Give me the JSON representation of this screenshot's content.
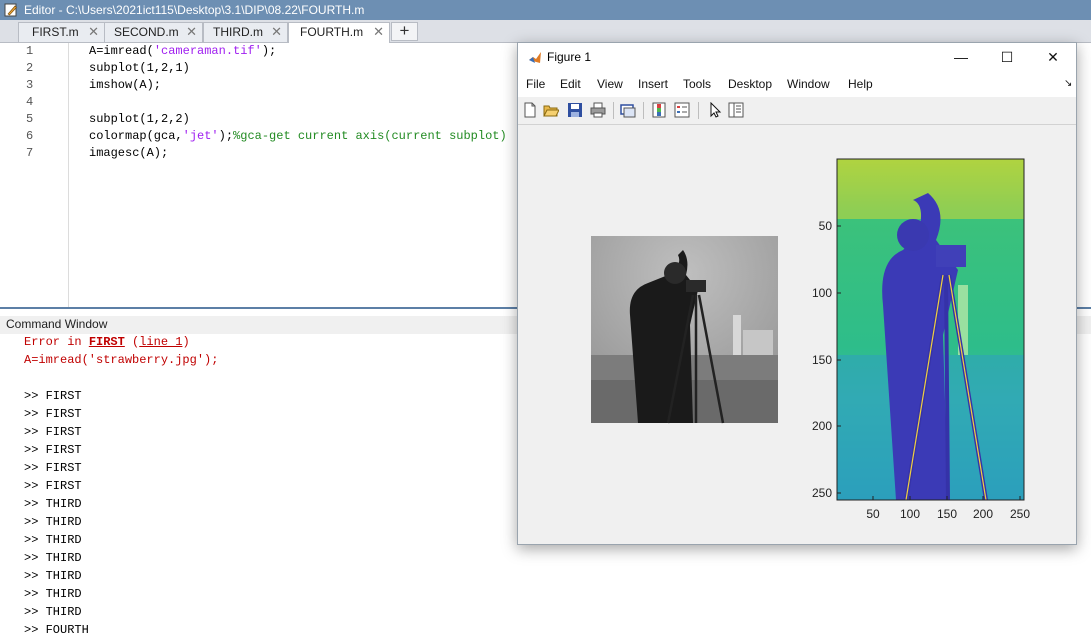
{
  "editor": {
    "title": "Editor - C:\\Users\\2021ict115\\Desktop\\3.1\\DIP\\08.22\\FOURTH.m",
    "tabs": [
      {
        "label": "FIRST.m",
        "active": false
      },
      {
        "label": "SECOND.m",
        "active": false
      },
      {
        "label": "THIRD.m",
        "active": false
      },
      {
        "label": "FOURTH.m",
        "active": true
      }
    ],
    "add_tab_label": "+",
    "close_glyph": "✕",
    "lines": [
      {
        "num": "1",
        "text": "A=imread('cameraman.tif');"
      },
      {
        "num": "2",
        "text": "subplot(1,2,1)"
      },
      {
        "num": "3",
        "text": "imshow(A);"
      },
      {
        "num": "4",
        "text": ""
      },
      {
        "num": "5",
        "text": "subplot(1,2,2)"
      },
      {
        "num": "6",
        "text": "colormap(gca,'jet');%gca-get current axis(current subplot)"
      },
      {
        "num": "7",
        "text": "imagesc(A);"
      }
    ],
    "line1_parts": {
      "a": "A=imread(",
      "s": "'cameraman.tif'",
      "b": ");"
    },
    "line6_parts": {
      "a": "colormap(gca,",
      "s": "'jet'",
      "b": ");",
      "c": "%gca-get current axis(current subplot)"
    }
  },
  "command_window": {
    "title": "Command Window",
    "error_parts": {
      "a": "Error in ",
      "link1": "FIRST",
      "b": " (",
      "link2": "line 1",
      "c": ")"
    },
    "error_line2": "A=imread('strawberry.jpg');",
    "history": [
      ">> FIRST",
      ">> FIRST",
      ">> FIRST",
      ">> FIRST",
      ">> FIRST",
      ">> FIRST",
      ">> THIRD",
      ">> THIRD",
      ">> THIRD",
      ">> THIRD",
      ">> THIRD",
      ">> THIRD",
      ">> THIRD",
      ">> FOURTH"
    ]
  },
  "figure": {
    "title": "Figure 1",
    "window_buttons": {
      "minimize": "—",
      "maximize": "☐",
      "close": "✕"
    },
    "menu": [
      "File",
      "Edit",
      "View",
      "Insert",
      "Tools",
      "Desktop",
      "Window",
      "Help"
    ],
    "menu_arrow": "↘",
    "toolbar_icons": [
      "new-figure-icon",
      "open-file-icon",
      "save-icon",
      "print-icon",
      "link-axes-icon",
      "colorbar-icon",
      "legend-icon",
      "pointer-icon",
      "property-inspector-icon"
    ],
    "axes": {
      "y_ticks": [
        "50",
        "100",
        "150",
        "200",
        "250"
      ],
      "x_ticks": [
        "50",
        "100",
        "150",
        "200",
        "250"
      ]
    }
  },
  "colors": {
    "title_bar": "#6d8fb3",
    "string": "#a020f0",
    "comment": "#228b22",
    "error": "#c00000"
  }
}
